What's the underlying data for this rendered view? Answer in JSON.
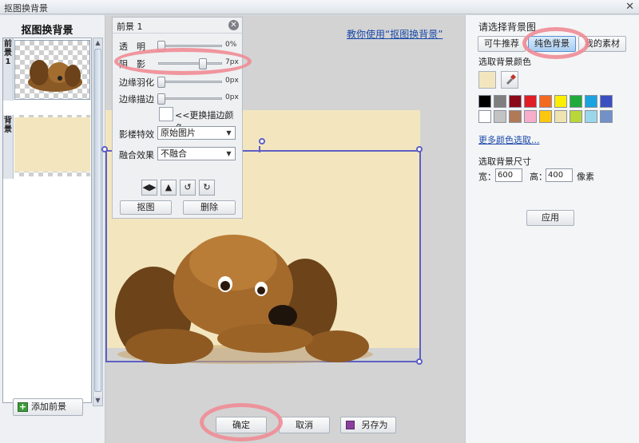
{
  "window": {
    "title": "抠图换背景",
    "close": "✕"
  },
  "left": {
    "title": "抠图换背景",
    "tab_fg": "前景1",
    "tab_bg": "背景",
    "add_button": "添加前景"
  },
  "center": {
    "help_link": "教你使用“抠图换背景”",
    "bg_color": "#f3e6bf"
  },
  "fg_panel": {
    "title": "前景 1",
    "sliders": [
      {
        "label": "透　明",
        "value": "0%",
        "level": 0
      },
      {
        "label": "阴　影",
        "value": "7px",
        "level": 0.7
      },
      {
        "label": "边缘羽化",
        "value": "0px",
        "level": 0
      },
      {
        "label": "边缘描边",
        "value": "0px",
        "level": 0
      }
    ],
    "change_color": "<<更换描边颜色",
    "effect_label": "影楼特效",
    "effect_value": "原始图片",
    "blend_label": "融合效果",
    "blend_value": "不融合",
    "cutout_button": "抠图",
    "delete_button": "删除"
  },
  "right": {
    "heading": "请选择背景图",
    "tabs": [
      "可牛推荐",
      "纯色背景",
      "我的素材"
    ],
    "active_tab": 1,
    "color_label": "选取背景颜色",
    "current_color": "#f3e6bf",
    "swatches_row1": [
      "#000000",
      "#7f7f7f",
      "#8b0a1a",
      "#e01e24",
      "#f26b21",
      "#fbee00",
      "#1faa3a",
      "#1ca2e1",
      "#3b4fc1"
    ],
    "swatches_row2": [
      "#ffffff",
      "#c3c3c3",
      "#b07a56",
      "#f8aecb",
      "#fdc60f",
      "#efe3b0",
      "#b9d63a",
      "#9bd7ea",
      "#7191c8"
    ],
    "more_colors": "更多颜色选取...",
    "size_label": "选取背景尺寸",
    "width_label": "宽：",
    "width_value": "600",
    "height_label": "高：",
    "height_value": "400",
    "unit": "像素",
    "apply_button": "应用"
  },
  "bottom": {
    "ok": "确定",
    "cancel": "取消",
    "save_as": "另存为"
  }
}
